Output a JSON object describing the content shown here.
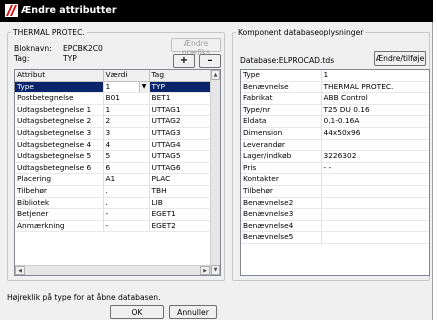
{
  "window": {
    "title": "Ændre attributter"
  },
  "left_group": {
    "legend": "THERMAL PROTEC.",
    "bloknavn_label": "Bloknavn:",
    "bloknavn_value": "EPCBK2C0",
    "tag_label": "Tag:",
    "tag_value": "TYP",
    "aendre_praefikst_label": "Ændre præfiks",
    "plus_label": "+",
    "minus_label": "–",
    "columns": [
      "Attribut",
      "Værdi",
      "Tag"
    ],
    "rows": [
      {
        "attribut": "Type",
        "vaerdi": "1",
        "tag": "TYP",
        "selected": true
      },
      {
        "attribut": "Postbetegnelse",
        "vaerdi": "B01",
        "tag": "BET1"
      },
      {
        "attribut": "Udtagsbetegnelse 1",
        "vaerdi": "1",
        "tag": "UTTAG1"
      },
      {
        "attribut": "Udtagsbetegnelse 2",
        "vaerdi": "2",
        "tag": "UTTAG2"
      },
      {
        "attribut": "Udtagsbetegnelse 3",
        "vaerdi": "3",
        "tag": "UTTAG3"
      },
      {
        "attribut": "Udtagsbetegnelse 4",
        "vaerdi": "4",
        "tag": "UTTAG4"
      },
      {
        "attribut": "Udtagsbetegnelse 5",
        "vaerdi": "5",
        "tag": "UTTAG5"
      },
      {
        "attribut": "Udtagsbetegnelse 6",
        "vaerdi": "6",
        "tag": "UTTAG6"
      },
      {
        "attribut": "Placering",
        "vaerdi": "A1",
        "tag": "PLAC"
      },
      {
        "attribut": "Tilbehør",
        "vaerdi": ".",
        "tag": "TBH"
      },
      {
        "attribut": "Bibliotek",
        "vaerdi": ".",
        "tag": "LIB"
      },
      {
        "attribut": "Betjener",
        "vaerdi": "-",
        "tag": "EGET1"
      },
      {
        "attribut": "Anmærkning",
        "vaerdi": "-",
        "tag": "EGET2"
      }
    ]
  },
  "right_group": {
    "legend": "Komponent databaseoplysninger",
    "database_label": "Database:ELPROCAD.tds",
    "aendre_tilfoej_label": "Ændre/tilføje",
    "rows": [
      {
        "name": "Type",
        "value": "1"
      },
      {
        "name": "Benævnelse",
        "value": "THERMAL PROTEC."
      },
      {
        "name": "Fabrikat",
        "value": "ABB Control"
      },
      {
        "name": "Type/nr",
        "value": "T25 DU 0.16"
      },
      {
        "name": "Eldata",
        "value": "0.1-0.16A"
      },
      {
        "name": "Dimension",
        "value": "44x50x96"
      },
      {
        "name": "Leverandør",
        "value": ""
      },
      {
        "name": "Lager/indkøb",
        "value": "3226302"
      },
      {
        "name": "Pris",
        "value": "-  -"
      },
      {
        "name": "Kontakter",
        "value": ""
      },
      {
        "name": "Tilbehør",
        "value": ""
      },
      {
        "name": "Benævnelse2",
        "value": ""
      },
      {
        "name": "Benævnelse3",
        "value": ""
      },
      {
        "name": "Benævnelse4",
        "value": ""
      },
      {
        "name": "Benævnelse5",
        "value": ""
      }
    ]
  },
  "footer": {
    "hint": "Højreklik på type for at åbne databasen.",
    "ok_label": "OK",
    "cancel_label": "Annuller"
  },
  "colors": {
    "titlebar": "#000000",
    "selection": "#0a246a",
    "dialog_bg": "#f0f0f0"
  }
}
